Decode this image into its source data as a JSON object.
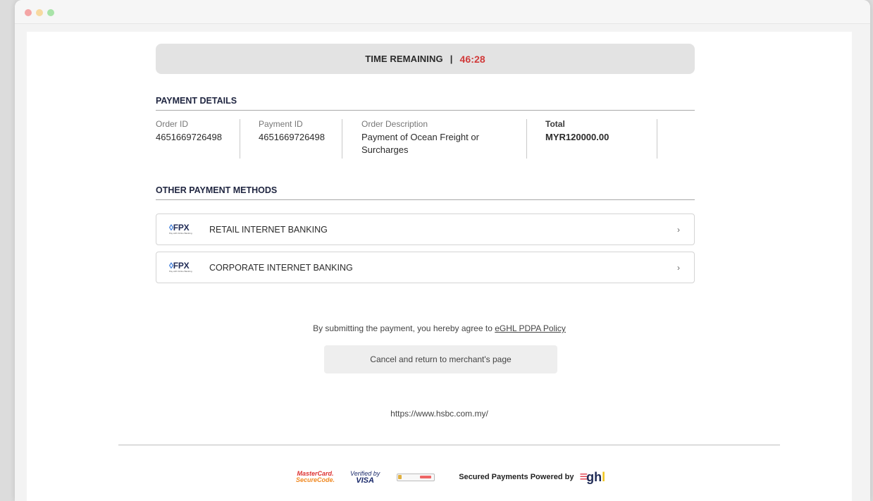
{
  "timer": {
    "label": "TIME REMAINING",
    "separator": "|",
    "value": "46:28"
  },
  "payment_details": {
    "title": "PAYMENT DETAILS",
    "columns": [
      {
        "label": "Order ID",
        "value": "4651669726498"
      },
      {
        "label": "Payment ID",
        "value": "4651669726498"
      },
      {
        "label": "Order Description",
        "value": "Payment of Ocean Freight or Surcharges"
      },
      {
        "label": "Total",
        "value": "MYR120000.00"
      }
    ]
  },
  "other_methods": {
    "title": "OTHER PAYMENT METHODS",
    "items": [
      {
        "logo": "FPX",
        "logo_sub": "Pay with Online Banking",
        "label": "RETAIL INTERNET BANKING",
        "chevron": "›"
      },
      {
        "logo": "FPX",
        "logo_sub": "Pay with Online Banking",
        "label": "CORPORATE INTERNET BANKING",
        "chevron": "›"
      }
    ]
  },
  "agreement": {
    "text": "By submitting the payment, you hereby agree to ",
    "link_text": "eGHL PDPA Policy"
  },
  "cancel_button": {
    "label": "Cancel and return to merchant's page"
  },
  "merchant_url": "https://www.hsbc.com.my/",
  "footer": {
    "mastercard_line1": "MasterCard.",
    "mastercard_line2": "SecureCode.",
    "visa_line1": "Verified by",
    "visa_line2": "VISA",
    "secured_text": "Secured Payments Powered by",
    "eghl_logo": "eghl"
  },
  "colors": {
    "timer_value": "#d13b3b",
    "heading": "#1f2540",
    "fpx_brand": "#1f2a55"
  }
}
